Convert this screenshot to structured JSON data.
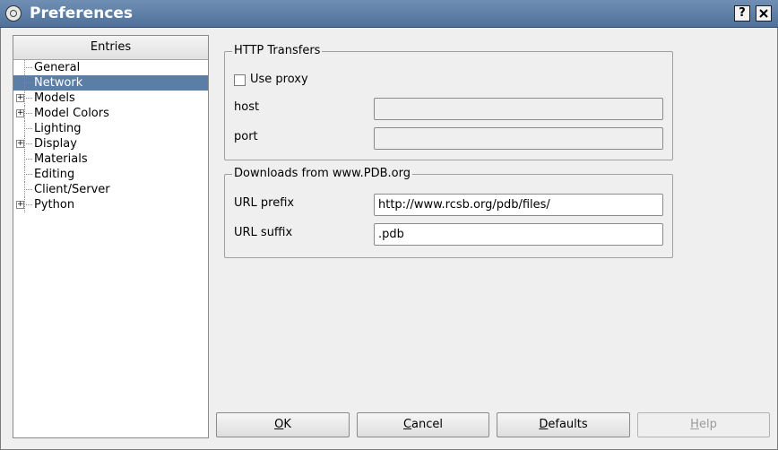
{
  "window": {
    "title": "Preferences",
    "help_button": "?",
    "close_button": "X"
  },
  "sidebar": {
    "header": "Entries",
    "items": [
      {
        "label": "General",
        "expandable": false,
        "selected": false
      },
      {
        "label": "Network",
        "expandable": false,
        "selected": true
      },
      {
        "label": "Models",
        "expandable": true,
        "selected": false
      },
      {
        "label": "Model Colors",
        "expandable": true,
        "selected": false
      },
      {
        "label": "Lighting",
        "expandable": false,
        "selected": false
      },
      {
        "label": "Display",
        "expandable": true,
        "selected": false
      },
      {
        "label": "Materials",
        "expandable": false,
        "selected": false
      },
      {
        "label": "Editing",
        "expandable": false,
        "selected": false
      },
      {
        "label": "Client/Server",
        "expandable": false,
        "selected": false
      },
      {
        "label": "Python",
        "expandable": true,
        "selected": false
      }
    ]
  },
  "http": {
    "group_title": "HTTP Transfers",
    "use_proxy_label": "Use proxy",
    "use_proxy_checked": false,
    "host_label": "host",
    "host_value": "",
    "port_label": "port",
    "port_value": ""
  },
  "pdb": {
    "group_title": "Downloads from www.PDB.org",
    "url_prefix_label": "URL prefix",
    "url_prefix_value": "http://www.rcsb.org/pdb/files/",
    "url_suffix_label": "URL suffix",
    "url_suffix_value": ".pdb"
  },
  "buttons": {
    "ok": {
      "accel": "O",
      "rest": "K"
    },
    "cancel": {
      "accel": "C",
      "rest": "ancel"
    },
    "defaults": {
      "accel": "D",
      "rest": "efaults"
    },
    "help": {
      "accel": "H",
      "rest": "elp"
    }
  },
  "colors": {
    "title_bar": "#5b7ea7",
    "selection": "#5b7ea7"
  }
}
